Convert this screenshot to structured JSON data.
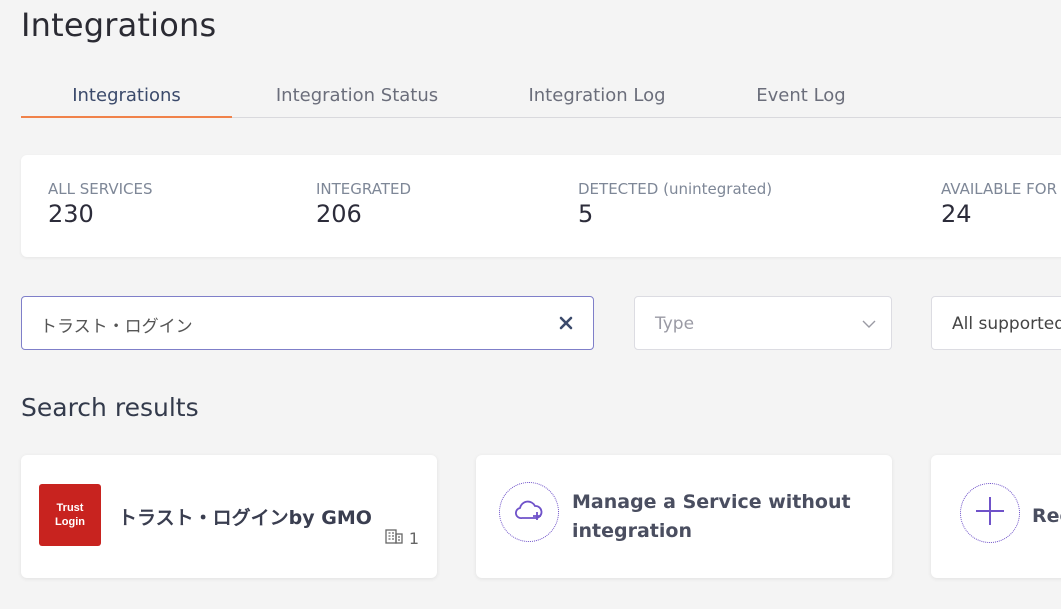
{
  "page": {
    "title": "Integrations"
  },
  "tabs": [
    {
      "label": "Integrations",
      "active": true
    },
    {
      "label": "Integration Status",
      "active": false
    },
    {
      "label": "Integration Log",
      "active": false
    },
    {
      "label": "Event Log",
      "active": false
    }
  ],
  "stats": [
    {
      "label": "ALL SERVICES",
      "value": "230"
    },
    {
      "label": "INTEGRATED",
      "value": "206"
    },
    {
      "label": "DETECTED (unintegrated)",
      "value": "5"
    },
    {
      "label": "AVAILABLE FOR",
      "value": "24"
    }
  ],
  "filters": {
    "search_value": "トラスト・ログイン",
    "type_placeholder": "Type",
    "supported_value": "All supported"
  },
  "results": {
    "title": "Search results",
    "service_card": {
      "logo_line1": "Trust",
      "logo_line2": "Login",
      "name": "トラスト・ログインby GMO",
      "org_count": "1"
    },
    "manage_card": {
      "line1": "Manage a Service without",
      "line2": "integration"
    },
    "request_card": {
      "label": "Rec"
    }
  },
  "colors": {
    "accent": "#f0824a",
    "brand_purple": "#6f52c9",
    "logo_red": "#c8231f"
  }
}
